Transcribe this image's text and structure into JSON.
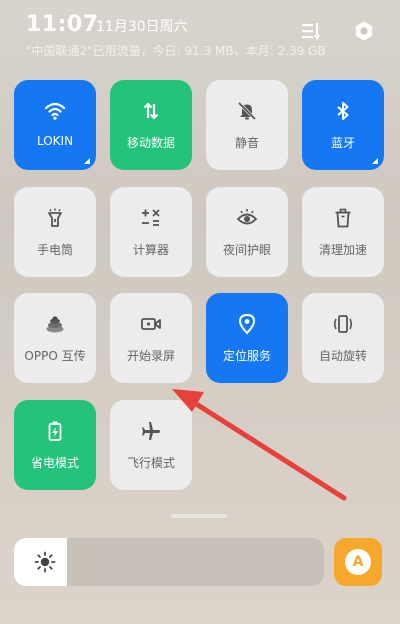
{
  "status": {
    "time": "11:07",
    "date": "11月30日周六",
    "traffic": "\"中国联通2\"已用流量，今日: 91.3 MB，本月: 2.39 GB"
  },
  "tiles": [
    {
      "label": "LOKIN",
      "icon": "wifi-icon",
      "state": "on"
    },
    {
      "label": "移动数据",
      "icon": "mobile-data-icon",
      "state": "on"
    },
    {
      "label": "静音",
      "icon": "mute-bell-icon",
      "state": "off"
    },
    {
      "label": "蓝牙",
      "icon": "bluetooth-icon",
      "state": "on"
    },
    {
      "label": "手电筒",
      "icon": "flashlight-icon",
      "state": "off"
    },
    {
      "label": "计算器",
      "icon": "calculator-icon",
      "state": "off"
    },
    {
      "label": "夜间护眼",
      "icon": "eye-icon",
      "state": "off"
    },
    {
      "label": "清理加速",
      "icon": "trash-icon",
      "state": "off"
    },
    {
      "label": "OPPO 互传",
      "icon": "share-stack-icon",
      "state": "off"
    },
    {
      "label": "开始录屏",
      "icon": "screen-record-icon",
      "state": "off"
    },
    {
      "label": "定位服务",
      "icon": "location-icon",
      "state": "on"
    },
    {
      "label": "自动旋转",
      "icon": "rotate-icon",
      "state": "off"
    },
    {
      "label": "省电模式",
      "icon": "battery-icon",
      "state": "on"
    },
    {
      "label": "飞行模式",
      "icon": "airplane-icon",
      "state": "off"
    }
  ],
  "brightness": {
    "level_percent": 17,
    "auto_label": "A"
  },
  "colors": {
    "active_blue": "#1677f4",
    "active_green": "#25c27a",
    "auto_orange": "#f7a72c",
    "annotation_arrow": "#e8413a"
  }
}
